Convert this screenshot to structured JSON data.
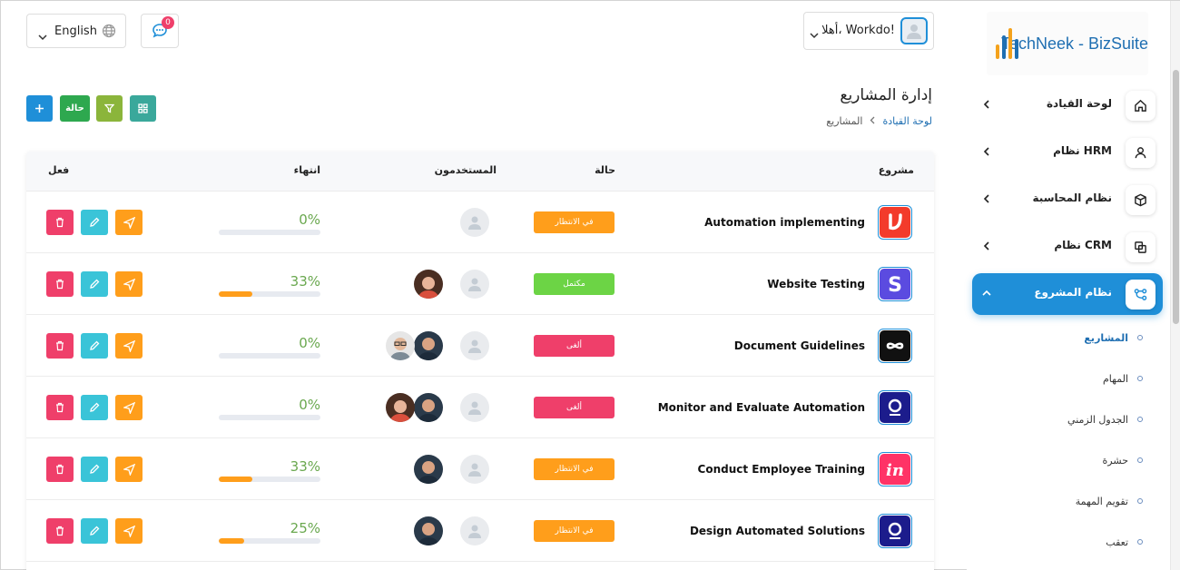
{
  "brand": {
    "name": "TechNeek - BizSuite"
  },
  "header": {
    "greeting": "أهلا، Workdo!",
    "chat_count": "0",
    "language": "English"
  },
  "page": {
    "title": "إدارة المشاريع",
    "breadcrumb": {
      "home": "لوحة القيادة",
      "current": "المشاريع"
    }
  },
  "toolbar": {
    "status_label": "حالة"
  },
  "sidebar": {
    "items": [
      {
        "label": "لوحة القيادة",
        "icon": "home-icon"
      },
      {
        "label": "نظام HRM",
        "icon": "user-icon"
      },
      {
        "label": "نظام المحاسبة",
        "icon": "box-icon"
      },
      {
        "label": "نظام CRM",
        "icon": "layers-icon"
      },
      {
        "label": "نظام المشروع",
        "icon": "share-icon"
      }
    ],
    "subitems": [
      {
        "label": "المشاريع"
      },
      {
        "label": "المهام"
      },
      {
        "label": "الجدول الزمني"
      },
      {
        "label": "حشرة"
      },
      {
        "label": "تقويم المهمة"
      },
      {
        "label": "تعقب"
      }
    ]
  },
  "table": {
    "headers": {
      "project": "مشروع",
      "status": "حالة",
      "users": "المستخدمون",
      "progress": "انتهاء",
      "action": "فعل"
    },
    "rows": [
      {
        "name": "Automation implementing",
        "status": "في الانتظار",
        "status_color": "#ff9e1b",
        "progress": 0,
        "progress_label": "0%",
        "icon": "vcf-logo-icon"
      },
      {
        "name": "Website Testing",
        "status": "مكتمل",
        "status_color": "#6cd445",
        "progress": 0.33,
        "progress_label": "33%",
        "icon": "s-logo-icon"
      },
      {
        "name": "Document Guidelines",
        "status": "ألغى",
        "status_color": "#ef3f6a",
        "progress": 0,
        "progress_label": "0%",
        "icon": "infinity-logo-icon"
      },
      {
        "name": "Monitor and Evaluate Automation",
        "status": "ألغى",
        "status_color": "#ef3f6a",
        "progress": 0,
        "progress_label": "0%",
        "icon": "circle-logo-icon"
      },
      {
        "name": "Conduct Employee Training",
        "status": "في الانتظار",
        "status_color": "#ff9e1b",
        "progress": 0.33,
        "progress_label": "33%",
        "icon": "in-logo-icon"
      },
      {
        "name": "Design Automated Solutions",
        "status": "في الانتظار",
        "status_color": "#ff9e1b",
        "progress": 0.25,
        "progress_label": "25%",
        "icon": "circle-logo-icon"
      }
    ]
  },
  "colors": {
    "accent": "#1f8fd8",
    "pending": "#ff9e1b",
    "complete": "#6cd445",
    "canceled": "#ef3f6a",
    "progress_text": "#6aa84f"
  }
}
